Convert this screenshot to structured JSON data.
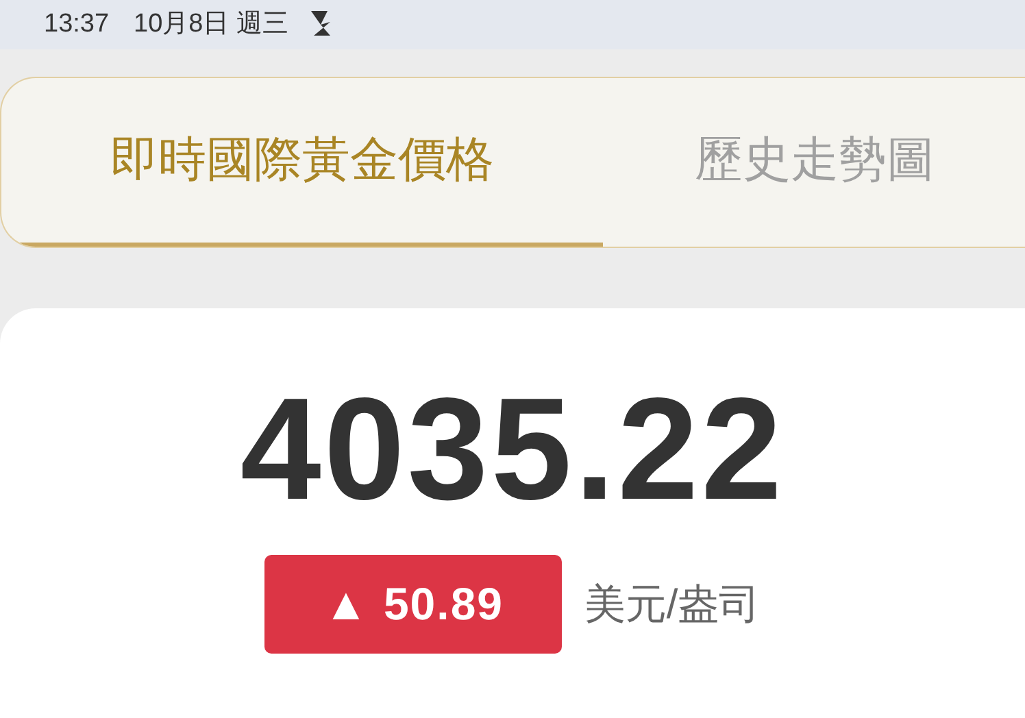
{
  "status_bar": {
    "time": "13:37",
    "date": "10月8日",
    "weekday": "週三"
  },
  "tabs": [
    {
      "label": "即時國際黃金價格",
      "selected": true
    },
    {
      "label": "歷史走勢圖",
      "selected": false
    }
  ],
  "price": {
    "value": "4035.22",
    "change": {
      "kind": "up",
      "arrow": "▲",
      "value": "50.89"
    },
    "unit": "美元/盎司"
  }
}
